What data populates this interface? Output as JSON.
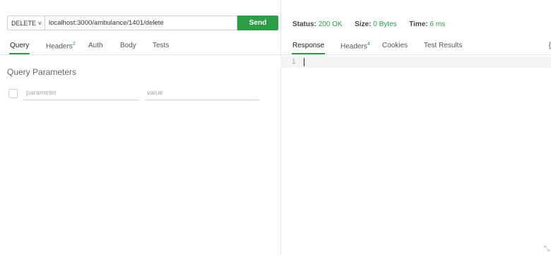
{
  "request": {
    "method": "DELETE",
    "url": "localhost:3000/ambulance/1401/delete",
    "send_label": "Send"
  },
  "request_tabs": [
    {
      "label": "Query",
      "active": true
    },
    {
      "label": "Headers",
      "count": "2"
    },
    {
      "label": "Auth"
    },
    {
      "label": "Body"
    },
    {
      "label": "Tests"
    }
  ],
  "query": {
    "title": "Query Parameters",
    "param_placeholder": "parameter",
    "value_placeholder": "value"
  },
  "response": {
    "status_label": "Status:",
    "status_value": "200 OK",
    "size_label": "Size:",
    "size_value": "0 Bytes",
    "time_label": "Time:",
    "time_value": "6 ms",
    "line_number": "1"
  },
  "response_tabs": [
    {
      "label": "Response",
      "active": true
    },
    {
      "label": "Headers",
      "count": "4"
    },
    {
      "label": "Cookies"
    },
    {
      "label": "Test Results"
    }
  ],
  "more_glyph": "{",
  "colors": {
    "accent": "#2d9c46"
  },
  "icons": [
    "chevron-down-icon",
    "resize-corner-icon"
  ]
}
